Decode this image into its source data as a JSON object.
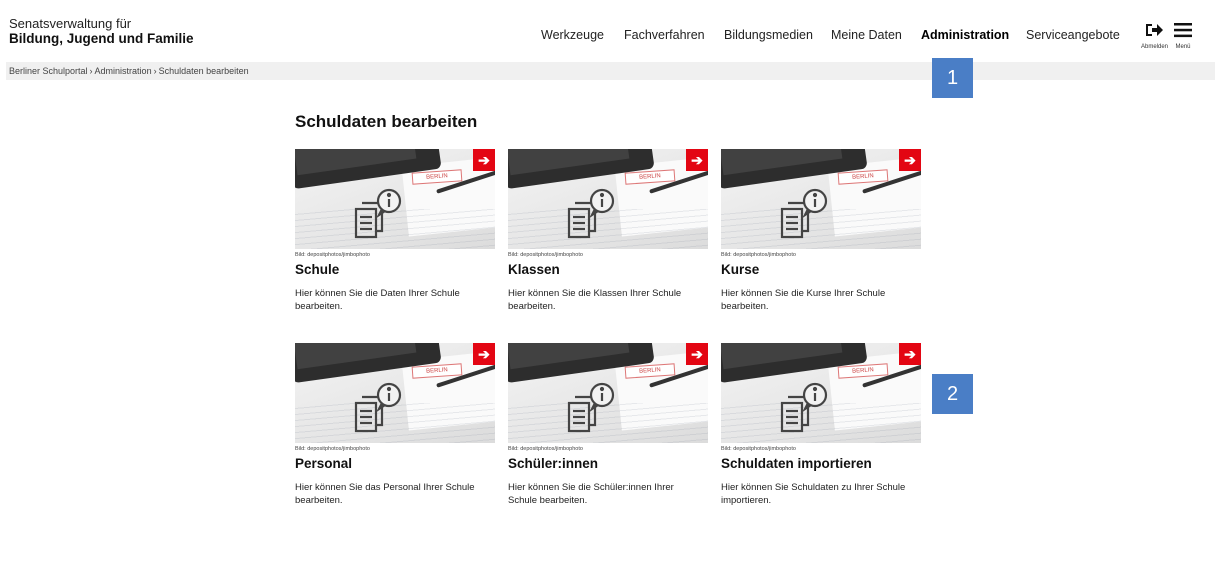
{
  "header": {
    "org_line1": "Senatsverwaltung für",
    "org_line2": "Bildung, Jugend und Familie",
    "nav": [
      "Werkzeuge",
      "Fachverfahren",
      "Bildungsmedien",
      "Meine Daten",
      "Administration",
      "Serviceangebote"
    ],
    "logout_label": "Abmelden",
    "menu_label": "Menü"
  },
  "breadcrumb": [
    "Berliner Schulportal",
    "Administration",
    "Schuldaten bearbeiten"
  ],
  "annotations": [
    "1",
    "2"
  ],
  "page_title": "Schuldaten bearbeiten",
  "cards": [
    {
      "credit": "Bild: depositphotos/jimbophoto",
      "title": "Schule",
      "desc": "Hier können Sie die Daten Ihrer Schule bearbeiten.",
      "stamp": "BERLIN"
    },
    {
      "credit": "Bild: depositphotos/jimbophoto",
      "title": "Klassen",
      "desc": "Hier können Sie die Klassen Ihrer Schule bearbeiten.",
      "stamp": "BERLIN"
    },
    {
      "credit": "Bild: depositphotos/jimbophoto",
      "title": "Kurse",
      "desc": "Hier können Sie die Kurse Ihrer Schule bearbeiten.",
      "stamp": "BERLIN"
    },
    {
      "credit": "Bild: depositphotos/jimbophoto",
      "title": "Personal",
      "desc": "Hier können Sie das Personal Ihrer Schule bearbeiten.",
      "stamp": "BERLIN"
    },
    {
      "credit": "Bild: depositphotos/jimbophoto",
      "title": "Schüler:innen",
      "desc": "Hier können Sie die Schüler:innen Ihrer Schule bearbeiten.",
      "stamp": "BERLIN"
    },
    {
      "credit": "Bild: depositphotos/jimbophoto",
      "title": "Schuldaten importieren",
      "desc": "Hier können Sie Schuldaten zu Ihrer Schule importieren.",
      "stamp": "BERLIN"
    }
  ],
  "colors": {
    "accent": "#e30613",
    "annotation": "#4a7ec6",
    "breadcrumb_bg": "#f0f0f0"
  },
  "icons": {
    "arrow": "arrow-right-icon",
    "document": "info-document-icon",
    "logout": "logout-icon",
    "menu": "hamburger-menu-icon"
  }
}
